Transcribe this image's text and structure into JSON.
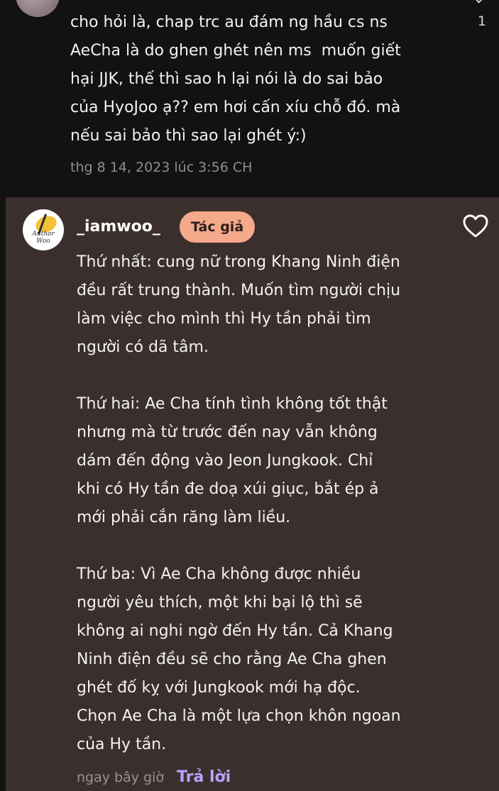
{
  "parent_comment": {
    "text": "cho hỏi là, chap trc au đám ng hầu cs ns\nAeCha là do ghen ghét nên ms  muốn giết\nhại JJK, thế thì sao h lại nói là do sai bảo\ncủa HyoJoo ạ?? em hơi cấn xíu chỗ đó. mà\nnếu sai bảo thì sao lại ghét ý:)",
    "timestamp": "thg 8 14, 2023 lúc 3:56 CH",
    "like_count": "1"
  },
  "reply": {
    "username": "_iamwoo_",
    "badge": "Tác giả",
    "avatar_text": "Author Woo",
    "text": "Thứ nhất: cung nữ trong Khang Ninh điện\nđều rất trung thành. Muốn tìm người chịu\nlàm việc cho mình thì Hy tần phải tìm\nngười có dã tâm.\n\nThứ hai: Ae Cha tính tình không tốt thật\nnhưng mà từ trước đến nay vẫn không\ndám đến động vào Jeon Jungkook. Chỉ\nkhi có Hy tần đe doạ xúi giục, bắt ép ả\nmới phải cắn răng làm liều.\n\nThứ ba: Vì Ae Cha không được nhiều\nngười yêu thích, một khi bại lộ thì sẽ\nkhông ai nghi ngờ đến Hy tần. Cả Khang\nNinh điện đều sẽ cho rằng Ae Cha ghen\nghét đố kỵ với Jungkook mới hạ độc.\nChọn Ae Cha là một lựa chọn khôn ngoan\ncủa Hy tần.",
    "timestamp": "ngay bây giờ",
    "reply_label": "Trả lời"
  },
  "colors": {
    "background": "#121212",
    "reply_background": "#3b2f2d",
    "badge": "#f4a98a",
    "link": "#b6a3ff"
  },
  "icons": {
    "like": "heart-outline-icon",
    "collapse": "chevron-icon"
  }
}
